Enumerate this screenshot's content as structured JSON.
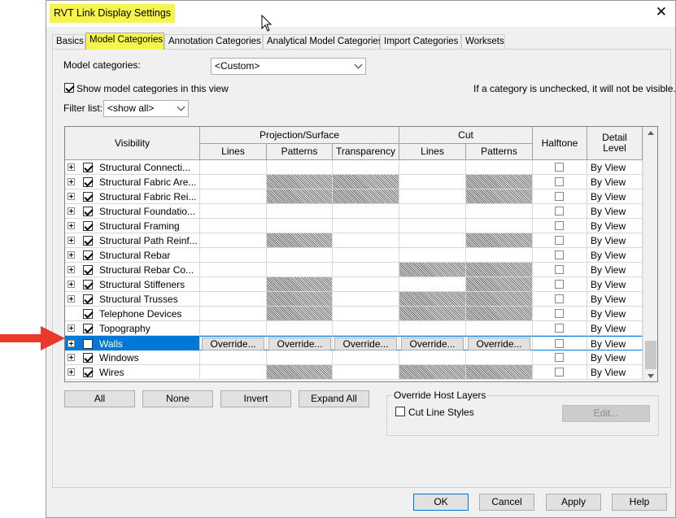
{
  "dialog": {
    "title": "RVT Link Display Settings",
    "close_glyph": "✕"
  },
  "tabs": [
    {
      "label": "Basics",
      "active": false
    },
    {
      "label": "Model Categories",
      "active": true
    },
    {
      "label": "Annotation Categories",
      "active": false
    },
    {
      "label": "Analytical Model Categories",
      "active": false
    },
    {
      "label": "Import Categories",
      "active": false
    },
    {
      "label": "Worksets",
      "active": false
    }
  ],
  "model_categories": {
    "label": "Model categories:",
    "value": "<Custom>"
  },
  "show_model_categories": {
    "label": "Show model categories in this view",
    "checked": true
  },
  "hint_text": "If a category is unchecked, it will not be visible.",
  "filter": {
    "label": "Filter list:",
    "value": "<show all>"
  },
  "grid": {
    "headers": {
      "visibility": "Visibility",
      "projection_surface": "Projection/Surface",
      "cut": "Cut",
      "lines": "Lines",
      "patterns": "Patterns",
      "transparency": "Transparency",
      "cut_lines": "Lines",
      "cut_patterns": "Patterns",
      "halftone": "Halftone",
      "detail_level": "Detail Level"
    },
    "override_label": "Override...",
    "rows": [
      {
        "name": "Structural Connecti...",
        "expand": true,
        "checked": true,
        "hatch": [
          false,
          false,
          false,
          false,
          false
        ],
        "detail": "By View"
      },
      {
        "name": "Structural Fabric Are...",
        "expand": true,
        "checked": true,
        "hatch": [
          false,
          true,
          true,
          false,
          true
        ],
        "detail": "By View"
      },
      {
        "name": "Structural Fabric Rei...",
        "expand": true,
        "checked": true,
        "hatch": [
          false,
          true,
          true,
          false,
          true
        ],
        "detail": "By View"
      },
      {
        "name": "Structural Foundatio...",
        "expand": true,
        "checked": true,
        "hatch": [
          false,
          false,
          false,
          false,
          false
        ],
        "detail": "By View"
      },
      {
        "name": "Structural Framing",
        "expand": true,
        "checked": true,
        "hatch": [
          false,
          false,
          false,
          false,
          false
        ],
        "detail": "By View"
      },
      {
        "name": "Structural Path Reinf...",
        "expand": true,
        "checked": true,
        "hatch": [
          false,
          true,
          false,
          false,
          true
        ],
        "detail": "By View"
      },
      {
        "name": "Structural Rebar",
        "expand": true,
        "checked": true,
        "hatch": [
          false,
          false,
          false,
          false,
          false
        ],
        "detail": "By View"
      },
      {
        "name": "Structural Rebar Co...",
        "expand": true,
        "checked": true,
        "hatch": [
          false,
          false,
          false,
          true,
          true
        ],
        "detail": "By View"
      },
      {
        "name": "Structural Stiffeners",
        "expand": true,
        "checked": true,
        "hatch": [
          false,
          true,
          false,
          false,
          true
        ],
        "detail": "By View"
      },
      {
        "name": "Structural Trusses",
        "expand": true,
        "checked": true,
        "hatch": [
          false,
          true,
          false,
          true,
          true
        ],
        "detail": "By View"
      },
      {
        "name": "Telephone Devices",
        "expand": false,
        "checked": true,
        "hatch": [
          false,
          true,
          false,
          true,
          true
        ],
        "detail": "By View"
      },
      {
        "name": "Topography",
        "expand": true,
        "checked": true,
        "hatch": [
          false,
          false,
          false,
          false,
          false
        ],
        "detail": "By View"
      },
      {
        "name": "Walls",
        "expand": true,
        "checked": false,
        "selected": true,
        "hatch": [
          false,
          false,
          false,
          false,
          false
        ],
        "detail": "By View"
      },
      {
        "name": "Windows",
        "expand": true,
        "checked": true,
        "hatch": [
          false,
          false,
          false,
          false,
          false
        ],
        "detail": "By View"
      },
      {
        "name": "Wires",
        "expand": true,
        "checked": true,
        "hatch": [
          false,
          true,
          false,
          true,
          true
        ],
        "detail": "By View"
      }
    ]
  },
  "buttons": {
    "all": "All",
    "none": "None",
    "invert": "Invert",
    "expand_all": "Expand All",
    "edit": "Edit...",
    "ok": "OK",
    "cancel": "Cancel",
    "apply": "Apply",
    "help": "Help"
  },
  "override_host_layers": {
    "title": "Override Host Layers",
    "cut_line_styles": "Cut Line Styles",
    "checked": false
  },
  "colors": {
    "highlight": "#f6f34a",
    "selection": "#0078d7",
    "arrow": "#e8392c"
  }
}
